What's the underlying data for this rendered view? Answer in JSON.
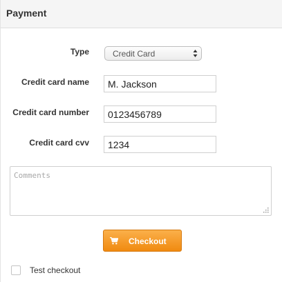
{
  "panel": {
    "title": "Payment"
  },
  "form": {
    "type_label": "Type",
    "type_selected": "Credit Card",
    "name_label": "Credit card name",
    "name_value": "M. Jackson",
    "number_label": "Credit card number",
    "number_value": "0123456789",
    "cvv_label": "Credit card cvv",
    "cvv_value": "1234",
    "comments_placeholder": "Comments"
  },
  "actions": {
    "checkout_label": "Checkout",
    "checkout_icon": "shopping-cart-icon",
    "button_color": "#f39a1e"
  },
  "options": {
    "test_checkout_label": "Test checkout",
    "test_checkout_checked": false
  }
}
